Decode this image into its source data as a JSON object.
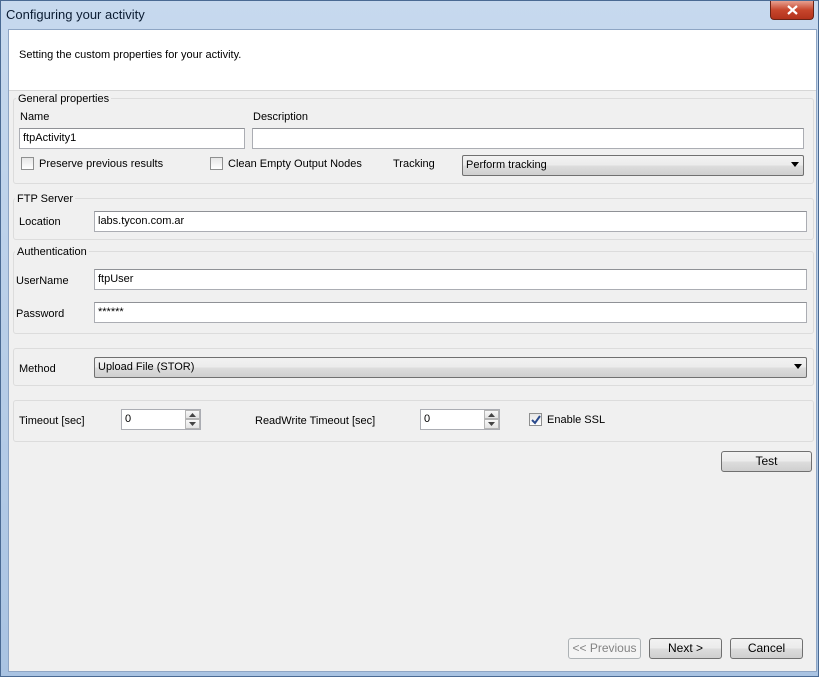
{
  "window": {
    "title": "Configuring your activity"
  },
  "header": {
    "text": "Setting the custom properties for your activity."
  },
  "general": {
    "group_title": "General properties",
    "name_label": "Name",
    "name_value": "ftpActivity1",
    "description_label": "Description",
    "description_value": "",
    "preserve_label": "Preserve previous results",
    "preserve_checked": false,
    "clean_label": "Clean Empty Output Nodes",
    "clean_checked": false,
    "tracking_label": "Tracking",
    "tracking_value": "Perform tracking"
  },
  "ftp": {
    "group_title": "FTP Server",
    "location_label": "Location",
    "location_value": "labs.tycon.com.ar"
  },
  "auth": {
    "group_title": "Authentication",
    "username_label": "UserName",
    "username_value": "ftpUser",
    "password_label": "Password",
    "password_value": "******"
  },
  "method": {
    "label": "Method",
    "value": "Upload File (STOR)"
  },
  "timeouts": {
    "timeout_label": "Timeout [sec]",
    "timeout_value": "0",
    "rw_timeout_label": "ReadWrite Timeout [sec]",
    "rw_timeout_value": "0",
    "ssl_label": "Enable SSL",
    "ssl_checked": true
  },
  "buttons": {
    "test": "Test",
    "previous": "<< Previous",
    "next": "Next >",
    "cancel": "Cancel"
  }
}
